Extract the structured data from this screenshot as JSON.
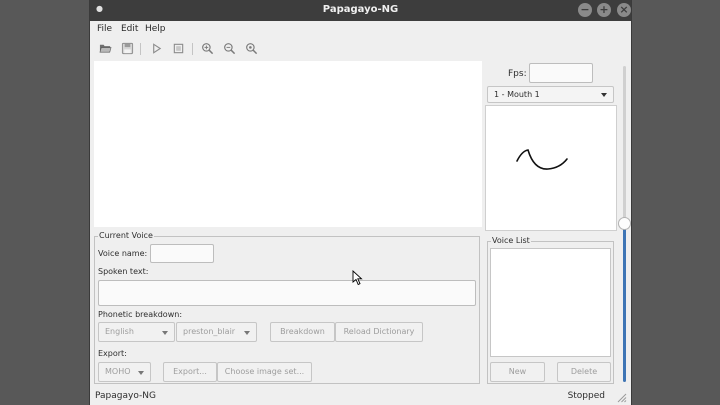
{
  "window": {
    "title": "Papagayo-NG"
  },
  "menu": {
    "file": "File",
    "edit": "Edit",
    "help": "Help"
  },
  "toolbar": {
    "icons": [
      "open-icon",
      "save-icon",
      "play-icon",
      "stop-icon",
      "zoom-in-icon",
      "zoom-out-icon",
      "zoom-reset-icon"
    ]
  },
  "right_panel": {
    "fps_label": "Fps:",
    "fps_value": "",
    "mouth_select": "1 - Mouth 1",
    "voice_list_title": "Voice List",
    "new_button": "New",
    "delete_button": "Delete"
  },
  "current_voice": {
    "group_title": "Current Voice",
    "voice_name_label": "Voice name:",
    "voice_name_value": "",
    "spoken_text_label": "Spoken text:",
    "spoken_text_value": "",
    "phonetic_label": "Phonetic breakdown:",
    "language": "English",
    "phoneme_set": "preston_blair",
    "breakdown_button": "Breakdown",
    "reload_dictionary_button": "Reload Dictionary",
    "export_label": "Export:",
    "export_format": "MOHO",
    "export_button": "Export...",
    "choose_image_set_button": "Choose image set..."
  },
  "status": {
    "left": "Papagayo-NG",
    "right": "Stopped"
  },
  "colors": {
    "titlebar": "#3d3d3d",
    "accent": "#3e75b5",
    "background": "#efefef"
  }
}
